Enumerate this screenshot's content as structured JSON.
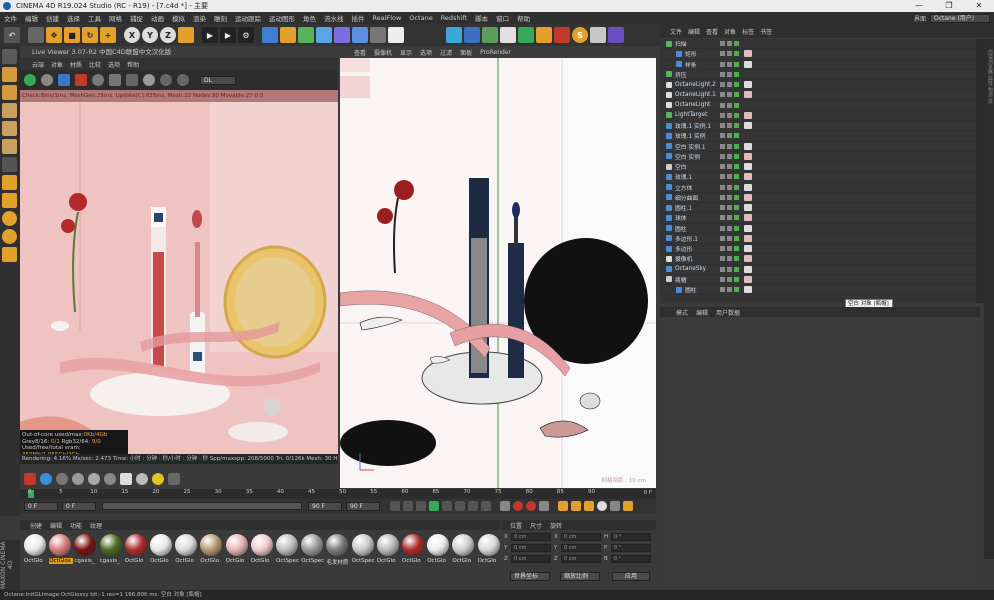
{
  "window": {
    "title": "CINEMA 4D R19.024 Studio (RC - R19) - [7.c4d *] - 主要",
    "controls": [
      "—",
      "❐",
      "✕"
    ]
  },
  "menubar": {
    "items": [
      "文件",
      "编辑",
      "创建",
      "选择",
      "工具",
      "网格",
      "捕捉",
      "动画",
      "模拟",
      "渲染",
      "雕刻",
      "运动跟踪",
      "运动图形",
      "角色",
      "流水线",
      "插件",
      "RealFlow",
      "Octane",
      "Redshift",
      "脚本",
      "窗口",
      "帮助"
    ],
    "layout_label": "界面",
    "layout_value": "Octane (用户)"
  },
  "toolbar": {
    "axis_labels": [
      "X",
      "Y",
      "Z"
    ]
  },
  "live_viewer": {
    "title": "Live Viewer 3.07-R2 中国C4D联盟中文汉化版",
    "menu": [
      "云端",
      "对象",
      "材质",
      "比较",
      "选项",
      "帮助"
    ],
    "render_mode": "DL",
    "status": "Check:8ms/1ms. MeshGen:25ms. Update[C]:635ms. Mesh:22 Nodes:90 Movable:27  0:0",
    "info": {
      "line1_label": "Out-of-core used/max:",
      "line1_value": "0Kb/4Gb",
      "line2_label": "Grey8/16: ",
      "line2_value": "0/1",
      "line2b_label": "Rgb32/64: ",
      "line2b_value": "9/0",
      "line3_label": "Used/free/total vram: ",
      "line3_value": "350Mb/1.055Gb/2Gb"
    },
    "bottom_status": "Rendering: 4.16%  Ms/sec: 2.473   Time: 小时 : 分钟 : 秒/小时 : 分钟 : 秒   Spp/maxspp: 208/5000   Tri: 0/126k   Mesh: 30   Hair"
  },
  "viewport": {
    "menu": [
      "查看",
      "摄像机",
      "显示",
      "选项",
      "过滤",
      "面板",
      "ProRender"
    ],
    "footer_label": "网格间距 : 10 cm"
  },
  "object_manager": {
    "tabs": [
      "文件",
      "编辑",
      "查看",
      "对象",
      "标签",
      "书签"
    ],
    "objects": [
      {
        "name": "扫描",
        "color": "#58b35a",
        "indent": 0
      },
      {
        "name": "矩形",
        "color": "#4a8fd6",
        "indent": 1
      },
      {
        "name": "样条",
        "color": "#4a8fd6",
        "indent": 1
      },
      {
        "name": "挤压",
        "color": "#58b35a",
        "indent": 0
      },
      {
        "name": "OctaneLight.2",
        "color": "#dddddd",
        "indent": 0
      },
      {
        "name": "OctaneLight.1",
        "color": "#dddddd",
        "indent": 0
      },
      {
        "name": "OctaneLight",
        "color": "#dddddd",
        "indent": 0
      },
      {
        "name": "LightTarget",
        "color": "#58b35a",
        "indent": 0
      },
      {
        "name": "玫瑰.1 实例.1",
        "color": "#4a8fd6",
        "indent": 0
      },
      {
        "name": "玫瑰.1 实例",
        "color": "#4a8fd6",
        "indent": 0
      },
      {
        "name": "空白 实例.1",
        "color": "#4a8fd6",
        "indent": 0
      },
      {
        "name": "空白 实例",
        "color": "#4a8fd6",
        "indent": 0
      },
      {
        "name": "空白",
        "color": "#cccccc",
        "indent": 0
      },
      {
        "name": "玫瑰.1",
        "color": "#4a8fd6",
        "indent": 0
      },
      {
        "name": "立方体",
        "color": "#4a8fd6",
        "indent": 0
      },
      {
        "name": "细分曲面",
        "color": "#4a8fd6",
        "indent": 0
      },
      {
        "name": "圆柱.1",
        "color": "#4a8fd6",
        "indent": 0
      },
      {
        "name": "球体",
        "color": "#4a8fd6",
        "indent": 0
      },
      {
        "name": "圆柱",
        "color": "#4a8fd6",
        "indent": 0
      },
      {
        "name": "多边形.1",
        "color": "#4a8fd6",
        "indent": 0
      },
      {
        "name": "多边形",
        "color": "#4a8fd6",
        "indent": 0
      },
      {
        "name": "摄像机",
        "color": "#dddddd",
        "indent": 0
      },
      {
        "name": "OctaneSky",
        "color": "#4a8fd6",
        "indent": 0
      },
      {
        "name": "瓶帽",
        "color": "#cccccc",
        "indent": 0
      },
      {
        "name": "圆柱",
        "color": "#4a8fd6",
        "indent": 1
      }
    ]
  },
  "tooltip": "空白 对象 [瓶帽]",
  "attributes": {
    "tabs": [
      "模式",
      "编辑",
      "用户数据"
    ]
  },
  "timeline": {
    "ticks": [
      "0",
      "5",
      "10",
      "15",
      "20",
      "25",
      "30",
      "35",
      "40",
      "45",
      "50",
      "55",
      "60",
      "65",
      "70",
      "75",
      "80",
      "85",
      "90"
    ],
    "frame_start": "0 F",
    "frame_current": "0 F",
    "frame_end": "90 F",
    "frame_max": "90 F",
    "current_frame_label": "0 F"
  },
  "materials": {
    "menu": [
      "创建",
      "编辑",
      "功能",
      "纹理"
    ],
    "items": [
      {
        "label": "OctGlo",
        "color": "#e8e8e8",
        "selected": false
      },
      {
        "label": "OctGlos",
        "color": "#d77b7b",
        "selected": true
      },
      {
        "label": "cgaxis_",
        "color": "#7a1212",
        "selected": false
      },
      {
        "label": "cgaxis_",
        "color": "#4c6b20",
        "selected": false
      },
      {
        "label": "OctGlo",
        "color": "#b02c2c",
        "selected": false
      },
      {
        "label": "OctGlo",
        "color": "#e6e6e6",
        "selected": false
      },
      {
        "label": "OctGlo",
        "color": "#d9d9d9",
        "selected": false
      },
      {
        "label": "OctGlo",
        "color": "#b39a72",
        "selected": false
      },
      {
        "label": "OctGlo",
        "color": "#e6b3b3",
        "selected": false
      },
      {
        "label": "OctGlo",
        "color": "#f0c8c8",
        "selected": false
      },
      {
        "label": "OctSpec",
        "color": "#bdbdbd",
        "selected": false
      },
      {
        "label": "OctSpec",
        "color": "#9a9a9a",
        "selected": false
      },
      {
        "label": "毛发材质",
        "color": "#7b7b7b",
        "selected": false
      },
      {
        "label": "OctSpec",
        "color": "#c8c8c8",
        "selected": false
      },
      {
        "label": "OctGlo",
        "color": "#b9b9b9",
        "selected": false
      },
      {
        "label": "OctGlo",
        "color": "#b02a2a",
        "selected": false
      },
      {
        "label": "OctGlo",
        "color": "#ececec",
        "selected": false
      },
      {
        "label": "OctGlo",
        "color": "#cfcfcf",
        "selected": false
      },
      {
        "label": "OctGlo",
        "color": "#d8d8d8",
        "selected": false
      }
    ]
  },
  "coordinates": {
    "tabs": [
      "位置",
      "尺寸",
      "旋转"
    ],
    "rows": [
      {
        "a": "X",
        "av": "0 cm",
        "b": "X",
        "bv": "0 cm",
        "c": "H",
        "cv": "0 °"
      },
      {
        "a": "Y",
        "av": "0 cm",
        "b": "Y",
        "bv": "0 cm",
        "c": "P",
        "cv": "0 °"
      },
      {
        "a": "Z",
        "av": "0 cm",
        "b": "Z",
        "bv": "0 cm",
        "c": "B",
        "cv": "0 °"
      }
    ],
    "mode_left": "世界坐标",
    "mode_right": "缩放比例",
    "apply": "应用"
  },
  "status_bar": "Octane:InitGLImage:OctGlossy  bit:-1 res=1  166.806 ms.        空白 对象 [瓶帽]",
  "maxon_label": "MAXON CINEMA 4D",
  "right_side_label": "内容浏览器 属性 构造 层"
}
